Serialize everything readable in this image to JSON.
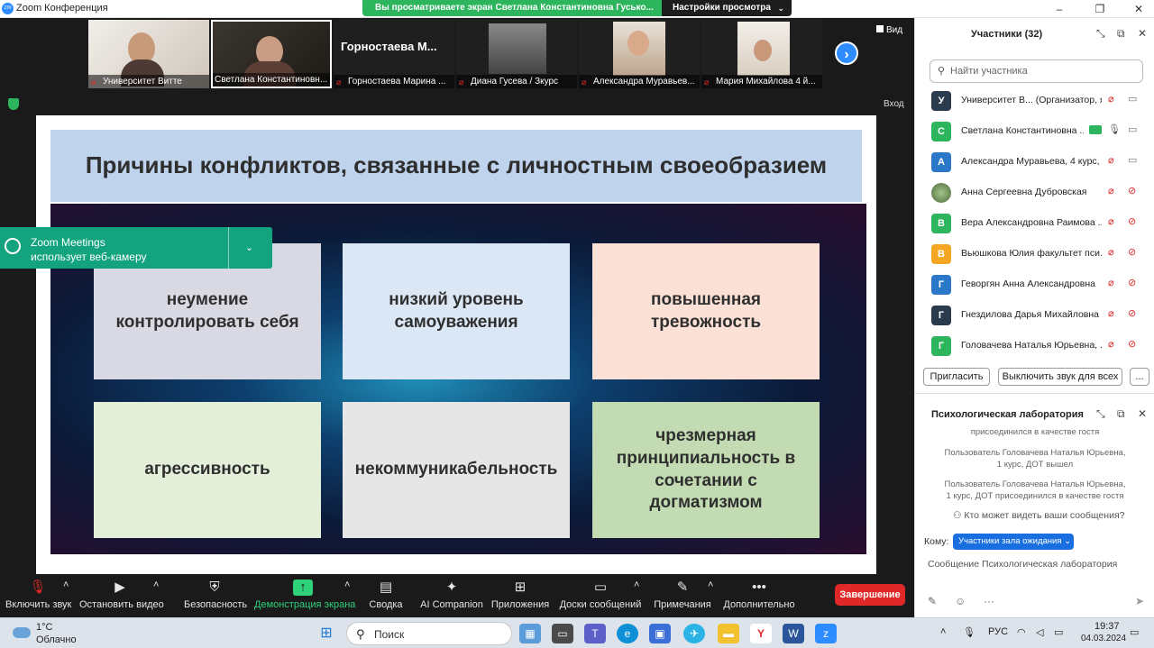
{
  "window": {
    "title": "Zoom Конференция",
    "logo": "zm"
  },
  "share_banner": {
    "text": "Вы просматриваете экран Светлана Константиновна Гусько...",
    "view_settings": "Настройки просмотра"
  },
  "gallery": {
    "tiles": [
      {
        "name": "Университет Витте"
      },
      {
        "name": "Светлана Константиновн..."
      },
      {
        "name": "Горностаева Марина ...",
        "display_title": "Горностаева М..."
      },
      {
        "name": "Диана Гусева / Зкурс"
      },
      {
        "name": "Александра Муравьев..."
      },
      {
        "name": "Мария Михайлова 4 й..."
      }
    ],
    "view_label": "Вид",
    "enter_label": "Вход"
  },
  "slide": {
    "title": "Причины конфликтов, связанные с личностным своеобразием",
    "cards": [
      {
        "text": "неумение контролировать себя",
        "color": "#d9d9e3"
      },
      {
        "text": "низкий уровень самоуважения",
        "color": "#dce7f5"
      },
      {
        "text": "повышенная тревожность",
        "color": "#fbe0d6"
      },
      {
        "text": "агрессивность",
        "color": "#e3efd9"
      },
      {
        "text": "некоммуникабельность",
        "color": "#e6e6e6"
      },
      {
        "text": "чрезмерная принципиальность в сочетании с догматизмом",
        "color": "#c3dbb2"
      }
    ]
  },
  "notification": {
    "line1": "Zoom Meetings",
    "line2": "использует веб-камеру"
  },
  "toolbar": {
    "items": [
      {
        "label": "Включить звук",
        "icon": "mic-muted-icon"
      },
      {
        "label": "Остановить видео",
        "icon": "video-icon"
      },
      {
        "label": "Безопасность",
        "icon": "shield-icon"
      },
      {
        "label": "Демонстрация экрана",
        "icon": "share-screen-icon"
      },
      {
        "label": "Сводка",
        "icon": "summary-icon"
      },
      {
        "label": "AI Companion",
        "icon": "sparkle-icon"
      },
      {
        "label": "Приложения",
        "icon": "apps-icon"
      },
      {
        "label": "Доски сообщений",
        "icon": "whiteboard-icon"
      },
      {
        "label": "Примечания",
        "icon": "notes-icon"
      },
      {
        "label": "Дополнительно",
        "icon": "more-icon"
      }
    ],
    "end_label": "Завершение"
  },
  "participants_panel": {
    "title": "Участники (32)",
    "search_placeholder": "Найти участника",
    "participants": [
      {
        "initial": "У",
        "name": "Университет В... (Организатор, я)",
        "color": "#2b3b4e"
      },
      {
        "initial": "С",
        "name": "Светлана Константиновна ...",
        "color": "#2db55d"
      },
      {
        "initial": "А",
        "name": "Александра Муравьева, 4 курс, ...",
        "color": "#2a78c8"
      },
      {
        "initial": "",
        "name": "Анна Сергеевна Дубровская",
        "color": "#6c8a4a"
      },
      {
        "initial": "В",
        "name": "Вера Александровна Раимова ...",
        "color": "#2db55d"
      },
      {
        "initial": "В",
        "name": "Вьюшкова Юлия факультет пси...",
        "color": "#f5a623"
      },
      {
        "initial": "Г",
        "name": "Геворгян Анна Александровна",
        "color": "#2a78c8"
      },
      {
        "initial": "Г",
        "name": "Гнездилова Дарья Михайловна",
        "color": "#2b3b4e"
      },
      {
        "initial": "Г",
        "name": "Головачева Наталья Юрьевна, ...",
        "color": "#2db55d"
      }
    ],
    "invite_label": "Пригласить",
    "mute_all_label": "Выключить звук для всех",
    "more_label": "..."
  },
  "chat_panel": {
    "title": "Психологическая лаборатория",
    "messages": [
      "присоединился в качестве гостя",
      "Пользователь Головачева Наталья Юрьевна, 1 курс, ДОТ вышел",
      "Пользователь Головачева Наталья Юрьевна, 1 курс, ДОТ присоединился в качестве гостя"
    ],
    "who_can_see": "Кто может видеть ваши сообщения?",
    "to_label": "Кому:",
    "to_value": "Участники зала ожидания",
    "input_placeholder": "Сообщение Психологическая лаборатория"
  },
  "taskbar": {
    "weather_temp": "1°C",
    "weather_condition": "Облачно",
    "search_placeholder": "Поиск",
    "language": "РУС",
    "time": "19:37",
    "date": "04.03.2024"
  }
}
